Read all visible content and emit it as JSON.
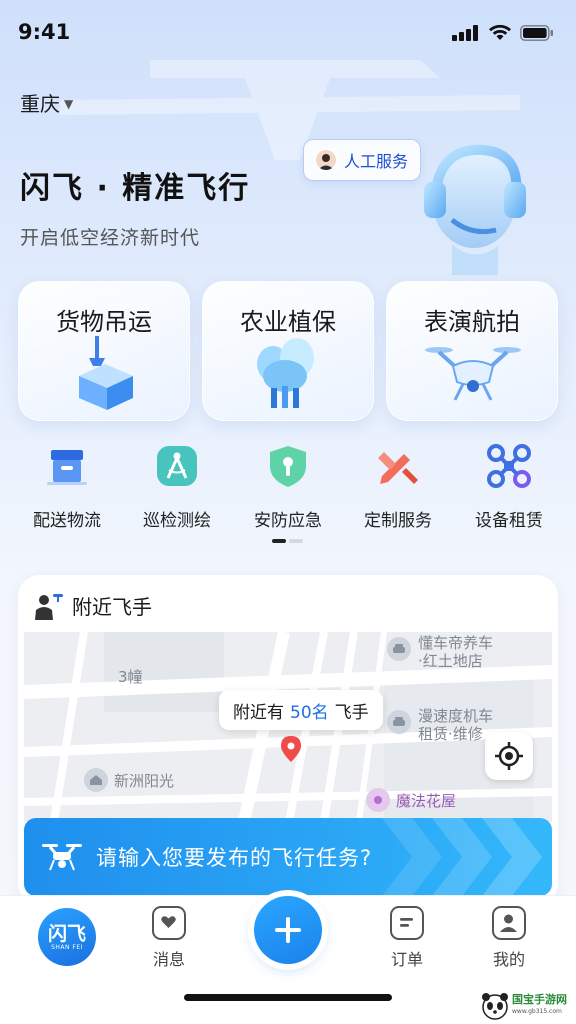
{
  "status_bar": {
    "time": "9:41"
  },
  "location": {
    "city": "重庆",
    "caret": "▼"
  },
  "hero": {
    "title": "闪飞 · 精准飞行",
    "subtitle": "开启低空经济新时代",
    "service_chip": "人工服务"
  },
  "feature_cards": [
    {
      "label": "货物吊运",
      "icon": "cargo-hoist-icon"
    },
    {
      "label": "农业植保",
      "icon": "crop-protection-icon"
    },
    {
      "label": "表演航拍",
      "icon": "aerial-drone-icon"
    }
  ],
  "categories": [
    {
      "label": "配送物流",
      "icon": "delivery-box-icon"
    },
    {
      "label": "巡检测绘",
      "icon": "survey-compass-icon"
    },
    {
      "label": "安防应急",
      "icon": "security-shield-icon"
    },
    {
      "label": "定制服务",
      "icon": "custom-service-icon"
    },
    {
      "label": "设备租赁",
      "icon": "drone-rental-icon"
    }
  ],
  "nearby": {
    "title": "附近飞手",
    "bubble_prefix": "附近有",
    "bubble_count": "50名",
    "bubble_suffix": "飞手",
    "map_labels": {
      "building": "3幢",
      "poi1_line1": "懂车帝养车",
      "poi1_line2": "·红土地店",
      "poi2_line1": "漫速度机车",
      "poi2_line2": "租赁·维修",
      "poi3": "新洲阳光",
      "poi4": "魔法花屋"
    }
  },
  "publish": {
    "placeholder": "请输入您要发布的飞行任务?"
  },
  "tabbar": {
    "logo_text": "闪飞",
    "logo_sub": "SHAN FEI",
    "messages": "消息",
    "orders": "订单",
    "mine": "我的"
  },
  "watermark": {
    "line1": "国宝手游网",
    "line2": "www.gb315.com"
  },
  "colors": {
    "accent": "#1f8fee",
    "brand_blue": "#1c4fd0"
  }
}
